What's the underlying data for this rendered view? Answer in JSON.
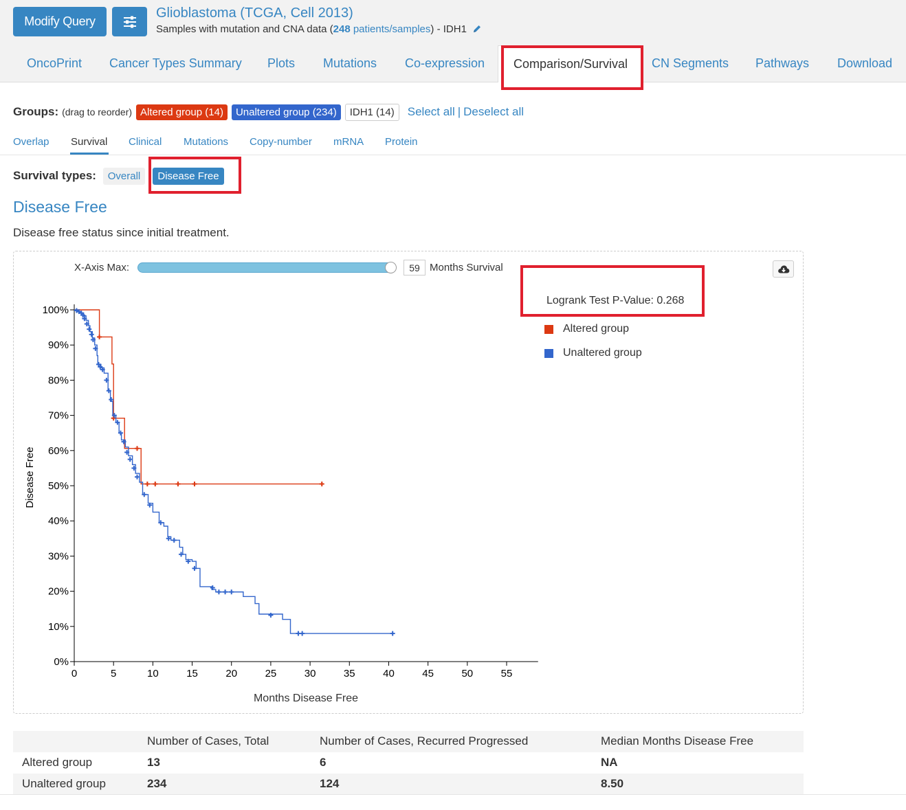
{
  "header": {
    "modify_query_label": "Modify Query",
    "settings_icon": "sliders-icon",
    "study_title": "Glioblastoma (TCGA, Cell 2013)",
    "subtitle_prefix": "Samples with mutation and CNA data (",
    "patients_count": "248",
    "patients_label": " patients/samples",
    "subtitle_suffix": ")  - IDH1",
    "edit_icon": "pencil-icon"
  },
  "nav_tabs": [
    {
      "label": "OncoPrint"
    },
    {
      "label": "Cancer Types Summary"
    },
    {
      "label": "Plots"
    },
    {
      "label": "Mutations"
    },
    {
      "label": "Co-expression"
    },
    {
      "label": "Comparison/Survival",
      "active": true
    },
    {
      "label": "CN Segments"
    },
    {
      "label": "Pathways"
    },
    {
      "label": "Download"
    }
  ],
  "groups": {
    "label": "Groups:",
    "hint": "(drag to reorder)",
    "badges": [
      {
        "label": "Altered group (14)",
        "color": "#dc3912"
      },
      {
        "label": "Unaltered group (234)",
        "color": "#3366cc"
      },
      {
        "label": "IDH1 (14)",
        "color": "#ffffff"
      }
    ],
    "select_all": "Select all",
    "separator": "|",
    "deselect_all": "Deselect all"
  },
  "sub_tabs": [
    {
      "label": "Overlap"
    },
    {
      "label": "Survival",
      "active": true
    },
    {
      "label": "Clinical"
    },
    {
      "label": "Mutations"
    },
    {
      "label": "Copy-number"
    },
    {
      "label": "mRNA"
    },
    {
      "label": "Protein"
    }
  ],
  "survival_types": {
    "label": "Survival types:",
    "options": [
      "Overall",
      "Disease Free"
    ],
    "selected": "Disease Free"
  },
  "section": {
    "title": "Disease Free",
    "description": "Disease free status since initial treatment."
  },
  "controls": {
    "xaxis_max_label": "X-Axis Max:",
    "xaxis_max_value": "59",
    "months_survival_label": "Months Survival",
    "download_icon": "cloud-download-icon",
    "slider_fraction": 1.0
  },
  "logrank": {
    "text": "Logrank Test P-Value: 0.268"
  },
  "legend": [
    {
      "label": "Altered group",
      "color": "#dc3912"
    },
    {
      "label": "Unaltered group",
      "color": "#3366cc"
    }
  ],
  "chart_data": {
    "type": "line",
    "xlabel": "Months Disease Free",
    "ylabel": "Disease Free",
    "xlim": [
      0,
      59
    ],
    "ylim": [
      0,
      100
    ],
    "xticks": [
      0,
      5,
      10,
      15,
      20,
      25,
      30,
      35,
      40,
      45,
      50,
      55
    ],
    "yticks": [
      0,
      10,
      20,
      30,
      40,
      50,
      60,
      70,
      80,
      90,
      100
    ],
    "ytick_labels": [
      "0%",
      "10%",
      "20%",
      "30%",
      "40%",
      "50%",
      "60%",
      "70%",
      "80%",
      "90%",
      "100%"
    ],
    "series": [
      {
        "name": "Altered group",
        "color": "#dc3912",
        "steps": [
          [
            0,
            100
          ],
          [
            3.2,
            92.3
          ],
          [
            4.8,
            84.6
          ],
          [
            5.0,
            69.2
          ],
          [
            6.3,
            69.2
          ],
          [
            6.4,
            60.6
          ],
          [
            8.5,
            50.5
          ],
          [
            31.5,
            50.5
          ]
        ],
        "censored": [
          [
            3.2,
            92.3
          ],
          [
            5.0,
            69.2
          ],
          [
            8.0,
            60.6
          ],
          [
            9.3,
            50.5
          ],
          [
            10.3,
            50.5
          ],
          [
            13.2,
            50.5
          ],
          [
            15.3,
            50.5
          ],
          [
            31.5,
            50.5
          ]
        ]
      },
      {
        "name": "Unaltered group",
        "color": "#3366cc",
        "steps": [
          [
            0,
            100
          ],
          [
            0.4,
            99.5
          ],
          [
            0.8,
            99.1
          ],
          [
            1.2,
            98.3
          ],
          [
            1.5,
            97.0
          ],
          [
            1.8,
            95.5
          ],
          [
            2.0,
            93.8
          ],
          [
            2.3,
            92.0
          ],
          [
            2.6,
            90.0
          ],
          [
            2.9,
            87.0
          ],
          [
            3.0,
            84.5
          ],
          [
            3.4,
            83.5
          ],
          [
            3.8,
            82.0
          ],
          [
            4.3,
            77.0
          ],
          [
            4.6,
            74.0
          ],
          [
            4.9,
            70.0
          ],
          [
            5.3,
            68.0
          ],
          [
            5.7,
            65.0
          ],
          [
            6.0,
            63.0
          ],
          [
            6.5,
            61.0
          ],
          [
            6.9,
            58.5
          ],
          [
            7.4,
            56.0
          ],
          [
            7.8,
            53.5
          ],
          [
            8.3,
            51.0
          ],
          [
            8.7,
            47.5
          ],
          [
            9.4,
            45.0
          ],
          [
            10.0,
            42.5
          ],
          [
            10.8,
            39.5
          ],
          [
            11.4,
            38.5
          ],
          [
            11.9,
            35.5
          ],
          [
            12.3,
            34.5
          ],
          [
            13.4,
            32.5
          ],
          [
            13.8,
            30.5
          ],
          [
            14.2,
            29.0
          ],
          [
            15.0,
            28.5
          ],
          [
            15.5,
            26.5
          ],
          [
            16.0,
            21.3
          ],
          [
            17.5,
            20.5
          ],
          [
            18.0,
            19.8
          ],
          [
            21.5,
            18.5
          ],
          [
            23.0,
            16.5
          ],
          [
            23.5,
            13.5
          ],
          [
            26.5,
            12.0
          ],
          [
            27.5,
            8.0
          ],
          [
            40.5,
            8.0
          ]
        ],
        "censored": [
          [
            0.3,
            99.8
          ],
          [
            0.6,
            99.5
          ],
          [
            0.9,
            99.1
          ],
          [
            1.1,
            98.5
          ],
          [
            1.3,
            97.5
          ],
          [
            1.6,
            96.0
          ],
          [
            1.9,
            94.5
          ],
          [
            2.2,
            93.0
          ],
          [
            2.4,
            91.5
          ],
          [
            2.7,
            89.0
          ],
          [
            3.1,
            84.5
          ],
          [
            3.3,
            83.8
          ],
          [
            3.6,
            83.0
          ],
          [
            4.1,
            80.0
          ],
          [
            4.4,
            77.0
          ],
          [
            4.7,
            74.5
          ],
          [
            5.1,
            70.0
          ],
          [
            5.5,
            68.0
          ],
          [
            5.9,
            65.0
          ],
          [
            6.3,
            62.5
          ],
          [
            6.7,
            59.5
          ],
          [
            7.1,
            57.5
          ],
          [
            7.6,
            55.0
          ],
          [
            8.0,
            52.5
          ],
          [
            8.9,
            47.5
          ],
          [
            9.6,
            44.5
          ],
          [
            11.0,
            39.5
          ],
          [
            12.0,
            35.0
          ],
          [
            12.7,
            34.5
          ],
          [
            13.6,
            30.5
          ],
          [
            14.5,
            28.5
          ],
          [
            15.3,
            26.5
          ],
          [
            17.6,
            21.0
          ],
          [
            18.4,
            19.8
          ],
          [
            19.2,
            19.8
          ],
          [
            20.0,
            19.8
          ],
          [
            25.0,
            13.2
          ],
          [
            28.5,
            8.0
          ],
          [
            29.0,
            8.0
          ],
          [
            40.5,
            8.0
          ]
        ]
      }
    ]
  },
  "summary_table": {
    "headers": [
      "",
      "Number of Cases, Total",
      "Number of Cases, Recurred Progressed",
      "Median Months Disease Free"
    ],
    "rows": [
      [
        "Altered group",
        "13",
        "6",
        "NA"
      ],
      [
        "Unaltered group",
        "234",
        "124",
        "8.50"
      ]
    ]
  }
}
